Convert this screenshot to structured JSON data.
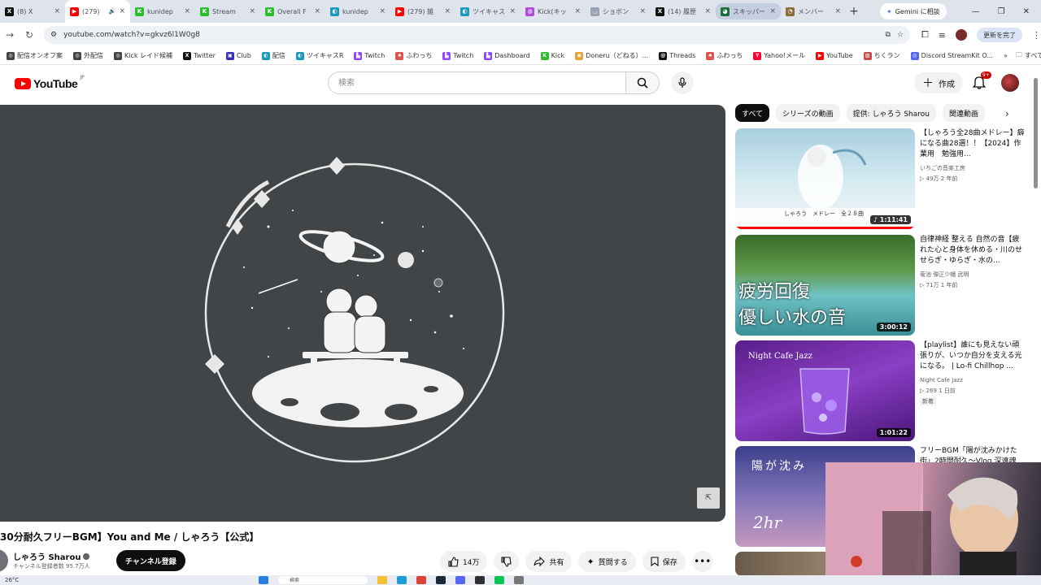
{
  "browser": {
    "tabs": [
      {
        "label": "(8) X",
        "fav": "X",
        "color": "#111111"
      },
      {
        "label": "(279) ",
        "fav": "▶",
        "color": "#ff0000",
        "active": true
      },
      {
        "label": "kunidep",
        "fav": "K",
        "color": "#2bbd2b"
      },
      {
        "label": "Stream",
        "fav": "K",
        "color": "#2bbd2b"
      },
      {
        "label": "Overall F",
        "fav": "K",
        "color": "#2bbd2b"
      },
      {
        "label": "kunidep",
        "fav": "◐",
        "color": "#1a9ab8"
      },
      {
        "label": "(279) 雑",
        "fav": "▶",
        "color": "#ff0000"
      },
      {
        "label": "ツイキャス",
        "fav": "◐",
        "color": "#1a9ab8"
      },
      {
        "label": "Kick(キッ",
        "fav": "◍",
        "color": "#b14bd6"
      },
      {
        "label": "ショボン",
        "fav": "◡",
        "color": "#9aa4b4"
      },
      {
        "label": "(14) 履歴",
        "fav": "X",
        "color": "#111111"
      },
      {
        "label": "スキッパー",
        "fav": "◕",
        "color": "#1b6e3e",
        "ghost": true
      },
      {
        "label": "メンバー",
        "fav": "◔",
        "color": "#8a6d3b"
      }
    ],
    "gemini_label": "Gemini に相談",
    "url": "youtube.com/watch?v=gkvz6l1W0g8",
    "update_label": "更新を完了",
    "bookmarks": [
      {
        "label": "配信オンオフ案",
        "icon": "◎",
        "color": "#444444"
      },
      {
        "label": "外配信",
        "icon": "◎",
        "color": "#444444"
      },
      {
        "label": "Kick レイド候補",
        "icon": "◎",
        "color": "#444444"
      },
      {
        "label": "Twitter",
        "icon": "X",
        "color": "#111111"
      },
      {
        "label": "Club",
        "icon": "▣",
        "color": "#3b2fb8"
      },
      {
        "label": "配信",
        "icon": "◐",
        "color": "#1a9ab8"
      },
      {
        "label": "ツイキャスR",
        "icon": "◐",
        "color": "#1a9ab8"
      },
      {
        "label": "Twitch",
        "icon": "▙",
        "color": "#9146ff"
      },
      {
        "label": "ふわっち",
        "icon": "♠",
        "color": "#e0524f"
      },
      {
        "label": "Twitch",
        "icon": "▙",
        "color": "#9146ff"
      },
      {
        "label": "Dashboard",
        "icon": "▙",
        "color": "#9146ff"
      },
      {
        "label": "Kick",
        "icon": "K",
        "color": "#2bbd2b"
      },
      {
        "label": "Doneru（どねる）...",
        "icon": "◉",
        "color": "#e8a23a"
      },
      {
        "label": "Threads",
        "icon": "@",
        "color": "#111111"
      },
      {
        "label": "ふわっち",
        "icon": "♠",
        "color": "#e0524f"
      },
      {
        "label": "Yahoo!メール",
        "icon": "Y",
        "color": "#ff0033"
      },
      {
        "label": "YouTube",
        "icon": "▶",
        "color": "#ff0000"
      },
      {
        "label": "ちくラン",
        "icon": "▨",
        "color": "#c94a4a"
      },
      {
        "label": "Discord StreamKit O...",
        "icon": "◎",
        "color": "#5865f2"
      }
    ],
    "bookmarks_more": "»",
    "all_bookmarks_label": "すべてのブックマーク"
  },
  "youtube": {
    "logo_text": "YouTube",
    "logo_region": "JP",
    "search_placeholder": "検索",
    "create_label": "作成",
    "notification_count": "9+",
    "video": {
      "title": "30分耐久フリーBGM】You and Me / しゃろう【公式】",
      "channel_name": "しゃろう Sharou",
      "subscribers": "チャンネル登録者数 95.7万人",
      "subscribe_label": "チャンネル登録",
      "likes": "14万",
      "share_label": "共有",
      "ask_label": "質問する",
      "save_label": "保存"
    },
    "chips": [
      "すべて",
      "シリーズの動画",
      "提供: しゃろう Sharou",
      "関連動画"
    ],
    "recommendations": [
      {
        "title": "【しゃろう全28曲メドレー】癖になる曲28選！！【2024】作業用　勉強用...",
        "channel": "いちごの音楽工房",
        "stats": "▷ 49万  2 年前",
        "duration": "♪ 1:11:41",
        "thumb_caption": "しゃろう　メドレー　全２８曲"
      },
      {
        "title": "自律神経 整える 自然の音【疲れた心と身体を休める・川のせせらぎ・ゆらぎ・水の...",
        "channel": "菊池 弾正少幡 武明",
        "stats": "▷ 71万  1 年前",
        "duration": "3:00:12",
        "thumb_line1": "疲労回復",
        "thumb_line2": "優しい水の音"
      },
      {
        "title": "【playlist】誰にも見えない頑張りが、いつか自分を支える光になる。 | Lo-fi Chillhop ...",
        "channel": "Night Cafe Jazz",
        "stats": "▷ 269  1 日前",
        "badge": "新着",
        "duration": "1:01:22",
        "thumb_caption": "Night Cafe Jazz"
      },
      {
        "title": "フリーBGM「陽が沈みかけた街」2時間耐久〜Vlog 深遠魂...",
        "thumb_line1": "陽が沈み",
        "thumb_line2": "2hr"
      }
    ]
  },
  "taskbar": {
    "weather": "26°C",
    "search_label": "検索"
  }
}
